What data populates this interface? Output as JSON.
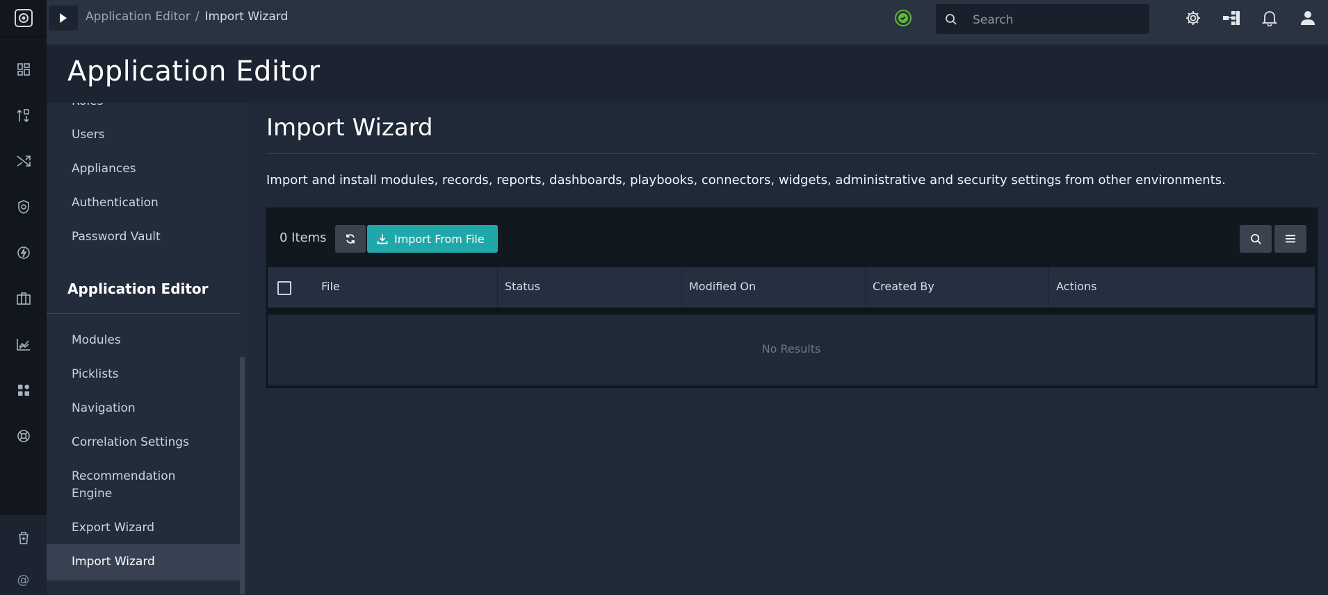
{
  "breadcrumb": {
    "parent": "Application Editor",
    "separator": "/",
    "current": "Import Wizard"
  },
  "search": {
    "placeholder": "Search"
  },
  "header": {
    "title": "Application Editor"
  },
  "subnav": {
    "items_top": [
      "Roles",
      "Users",
      "Appliances",
      "Authentication",
      "Password Vault"
    ],
    "section_title": "Application Editor",
    "items": [
      "Modules",
      "Picklists",
      "Navigation",
      "Correlation Settings",
      "Recommendation Engine",
      "Export Wizard",
      "Import Wizard"
    ],
    "active": "Import Wizard"
  },
  "main": {
    "title": "Import Wizard",
    "description": "Import and install modules, records, reports, dashboards, playbooks, connectors, widgets, administrative and security settings from other environments."
  },
  "grid": {
    "count_label": "0 Items",
    "import_button": "Import From File",
    "columns": [
      "File",
      "Status",
      "Modified On",
      "Created By",
      "Actions"
    ],
    "empty_text": "No Results"
  },
  "colors": {
    "accent": "#20a7a9",
    "status_ok": "#5dbb2f"
  },
  "icons": {
    "rail": [
      "dashboard-icon",
      "queue-icon",
      "shuffle-icon",
      "shield-icon",
      "automation-icon",
      "briefcase-icon",
      "analytics-icon",
      "apps-icon",
      "help-icon"
    ],
    "rail_bottom": [
      "recycle-bin-icon",
      "at-icon"
    ],
    "top": [
      "settings-icon",
      "hierarchy-icon",
      "notifications-icon",
      "user-icon"
    ]
  }
}
